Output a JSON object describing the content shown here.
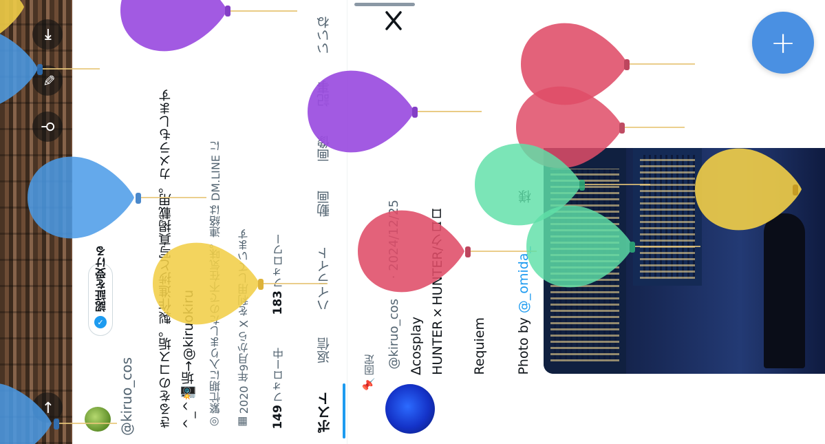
{
  "profile": {
    "verify_label": "認証を受ける",
    "handle": "@kiruo_cos",
    "bio_line1": "きるをのコス垢。製作進捗と写真掲載用。カメラもします",
    "bio_line2": "^_^📸垢→@kiruokiru",
    "status_text": "繁忙期に入りましたので不在気味。連絡は DM.LINE に",
    "joined_text": "2020 年9月から X を利用しています",
    "following_count": "149",
    "following_label": "フォロー中",
    "followers_count": "183",
    "followers_label": "フォロワー"
  },
  "tabs": [
    "ポスト",
    "返信",
    "ハイライト",
    "動画",
    "画像",
    "記事",
    "いいね"
  ],
  "post": {
    "pinned_label": "固定",
    "author": "@kiruo_cos",
    "date": "· 2024/12/25",
    "line1": "∆cosplay",
    "line2": "HUNTER×HUNTER/クロロ",
    "line3": "Requiem",
    "photo_by": "Photo by",
    "photo_credit": "@_omida_",
    "photo_suffix": "様"
  },
  "icons": {
    "logout": "logout-icon",
    "edit": "pencil-icon",
    "search": "search-icon",
    "back": "arrow-back-icon",
    "x_logo": "x-logo-icon",
    "compose": "plus-icon"
  },
  "fab_label": "+",
  "colors": {
    "accent": "#1d9bf0",
    "fab": "#4a90e2",
    "balloon_purple": "#9b4de0",
    "balloon_blue": "#4a9be8",
    "balloon_yellow": "#f2cf48",
    "balloon_red": "#e04d68",
    "balloon_green": "#5fe0a8"
  }
}
